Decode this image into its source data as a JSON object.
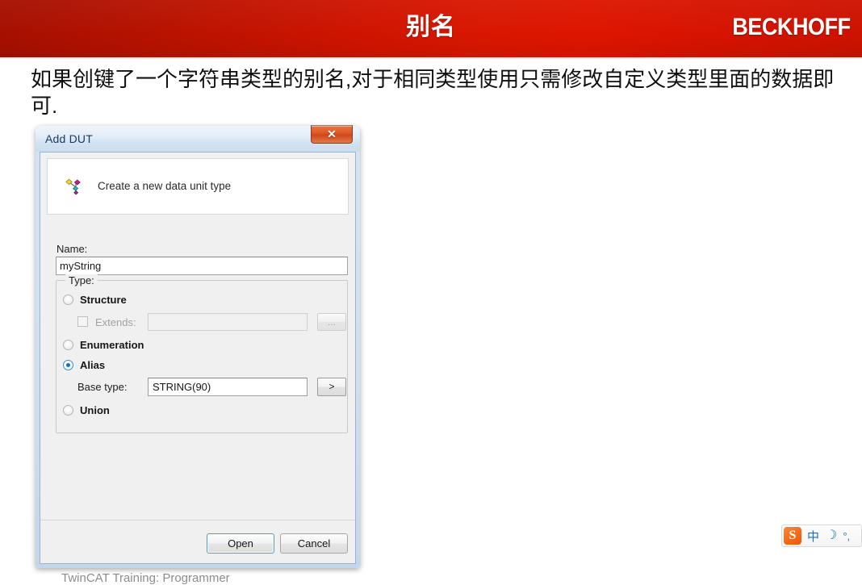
{
  "header": {
    "title": "别名",
    "brand": "BECKHOFF"
  },
  "slide": {
    "paragraph": "如果创键了一个字符串类型的别名,对于相同类型使用只需修改自定义类型里面的数据即可.",
    "footnote": "TwinCAT Training: Programmer"
  },
  "dialog": {
    "title": "Add DUT",
    "close_glyph": "✕",
    "banner_label": "Create a new data unit type",
    "name_label": "Name:",
    "name_value": "myString",
    "name_placeholder": "Name",
    "type_group_caption": "Type:",
    "options": {
      "structure": "Structure",
      "enumeration": "Enumeration",
      "alias": "Alias",
      "union": "Union"
    },
    "extends": {
      "label": "Extends:",
      "value": "",
      "placeholder": "",
      "browse_label": "..."
    },
    "base_type": {
      "label": "Base type:",
      "value": "STRING(90)",
      "placeholder": "",
      "browse_label": ">"
    },
    "buttons": {
      "open": "Open",
      "cancel": "Cancel"
    }
  },
  "ime": {
    "logo": "S",
    "mode": "中",
    "moon": "☽",
    "punct": "°,"
  },
  "colors": {
    "banner_red_dark": "#a50f00",
    "banner_red_light": "#dd1500",
    "accent_blue": "#1a70b8",
    "close_orange": "#dd5a26",
    "ime_blue": "#1f6fb5"
  }
}
